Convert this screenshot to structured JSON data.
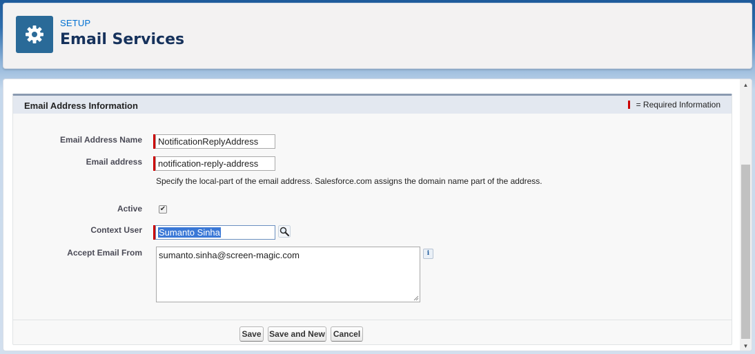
{
  "header": {
    "breadcrumb": "SETUP",
    "title": "Email Services",
    "icon": "gear-icon",
    "icon_bg": "#2a6a98"
  },
  "section": {
    "title": "Email Address Information",
    "required_legend": "= Required Information",
    "required_color": "#c00000"
  },
  "form": {
    "email_address_name": {
      "label": "Email Address Name",
      "value": "NotificationReplyAddress"
    },
    "email_address": {
      "label": "Email address",
      "value": "notification-reply-address"
    },
    "help_text": "Specify the local-part of the email address. Salesforce.com assigns the domain name part of the address.",
    "active": {
      "label": "Active",
      "checked": true,
      "check_glyph": "✔"
    },
    "context_user": {
      "label": "Context User",
      "value": "Sumanto Sinha",
      "lookup_icon": "magnifier-icon"
    },
    "accept_email_from": {
      "label": "Accept Email From",
      "value": "sumanto.sinha@screen-magic.com",
      "info_icon": "i"
    }
  },
  "buttons": {
    "save": "Save",
    "save_and_new": "Save and New",
    "cancel": "Cancel"
  },
  "scrollbar": {
    "up": "▲",
    "down": "▼"
  }
}
